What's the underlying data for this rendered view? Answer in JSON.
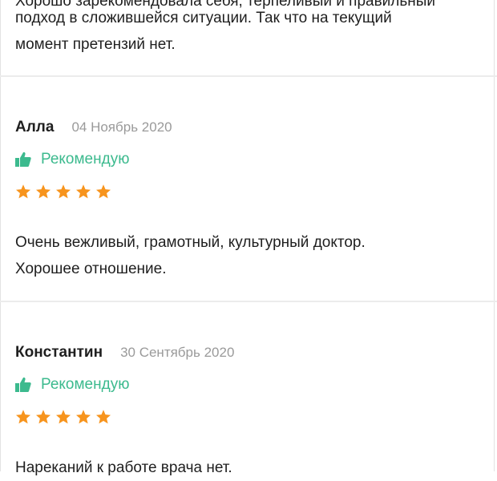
{
  "reviews": [
    {
      "text_lines": [
        "Хорошо зарекомендовала себя, терпеливый и правильный",
        "подход в сложившейся ситуации. Так что на текущий",
        "момент претензий нет."
      ]
    },
    {
      "author": "Алла",
      "date": "04 Ноябрь 2020",
      "recommend": "Рекомендую",
      "rating": 5,
      "text_lines": [
        "Очень вежливый, грамотный, культурный доктор.",
        "Хорошее отношение."
      ]
    },
    {
      "author": "Константин",
      "date": "30 Сентябрь 2020",
      "recommend": "Рекомендую",
      "rating": 5,
      "text_lines": [
        "Нареканий к работе врача нет."
      ]
    }
  ],
  "colors": {
    "accent_green": "#3cba8e",
    "star_orange": "#f7941d",
    "date_gray": "#9a9a9a"
  },
  "icons": [
    "thumbs-up-icon",
    "star-icon"
  ]
}
